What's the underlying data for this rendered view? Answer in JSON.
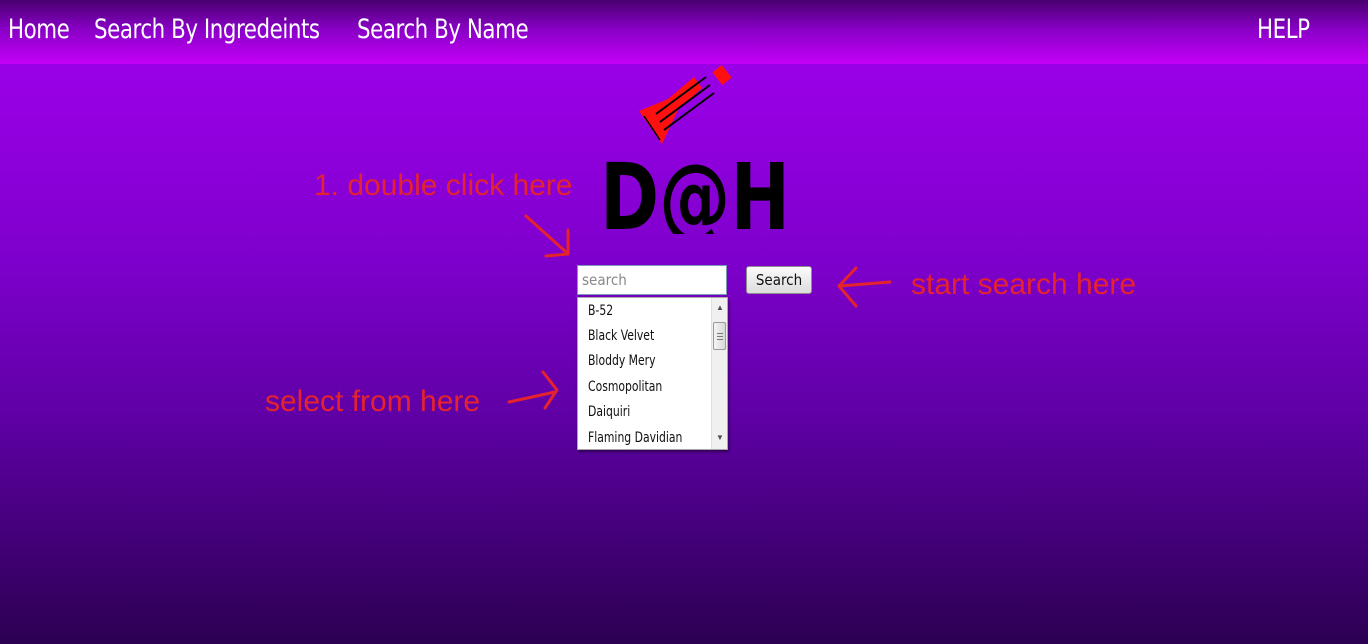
{
  "nav": {
    "home": "Home",
    "search_by_ingredients": "Search By Ingredeints",
    "search_by_name": "Search By Name",
    "help": "HELP"
  },
  "logo": {
    "text": "D@H"
  },
  "annotations": {
    "double_click": "1. double click here",
    "start_search": "start search here",
    "select_from": "select from here"
  },
  "search": {
    "placeholder": "search",
    "button_label": "Search"
  },
  "dropdown": {
    "items": [
      "B-52",
      "Black Velvet",
      "Bloddy Mery",
      "Cosmopolitan",
      "Daiquiri",
      "Flaming Davidian"
    ]
  },
  "colors": {
    "background": "#8a00d8",
    "annotation": "#e5232d",
    "logo_accent": "#ff1010"
  },
  "icons": {
    "logo_bottle": "bottle-icon",
    "scroll_up": "scroll-up-arrow-icon",
    "scroll_down": "scroll-down-arrow-icon"
  }
}
